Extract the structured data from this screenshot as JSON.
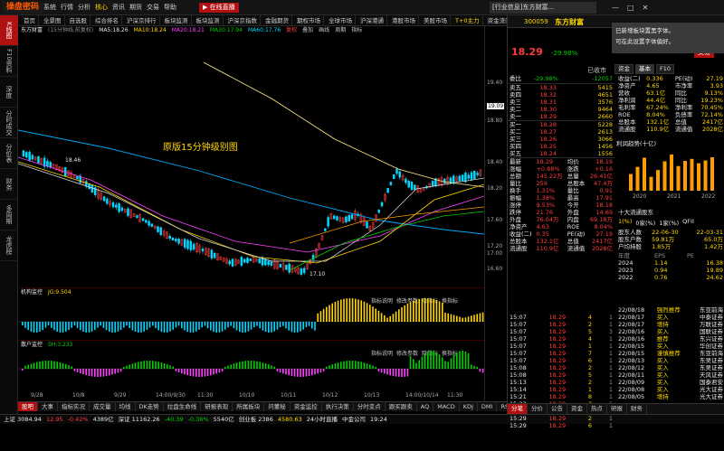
{
  "app": {
    "logo": "操盘密码",
    "menu": [
      "首页",
      "全景图",
      "自选股",
      "行情",
      "核心",
      "资讯",
      "交易",
      "数据"
    ],
    "menu2": [
      "系统",
      "行情",
      "分析",
      "核心",
      "资讯",
      "期货",
      "交易",
      "帮助"
    ],
    "ticker": "[行业信息]东方财富...",
    "window_controls": [
      "—",
      "□",
      "✕"
    ]
  },
  "top_menu": [
    "首页",
    "全景图",
    "自选股",
    "综合排名",
    "沪深京排行",
    "板块监测",
    "板块监测",
    "沪深京指数",
    "金融期货",
    "期权市场",
    "全球市场",
    "沪深港通",
    "港股市场",
    "美股市场",
    "T+0主力",
    "资金流向"
  ],
  "stock": {
    "code": "300059",
    "name": "东方财富",
    "price": "18.29",
    "change": "-29.98%",
    "status": "已收市",
    "tabs": [
      "资金",
      "基本",
      "F10"
    ],
    "btn": "交易"
  },
  "notice": {
    "l1": "已新增板块置黑字体。",
    "l2": "可在此设置字体偏好。"
  },
  "sidenav": [
    "K线图",
    "F10资料",
    "深度",
    "分时成交",
    "分价表",
    "财务",
    "多周期",
    "龙虎榜"
  ],
  "period_tabs": [
    "1分",
    "5日",
    "1分钟",
    "5分钟",
    "15分钟",
    "30分钟",
    "60分钟",
    "日线",
    "周线",
    "月线",
    "更多周期"
  ],
  "chart_head": {
    "name": "东方财富",
    "period": "(15分钟线,前复权)",
    "ma": [
      {
        "n": "MA5",
        "v": "18.26"
      },
      {
        "n": "MA10",
        "v": "18.24"
      },
      {
        "n": "MA20",
        "v": "18.21"
      },
      {
        "n": "MA30",
        "v": "17.94"
      },
      {
        "n": "MA60",
        "v": "17.76"
      }
    ],
    "links": [
      "复权",
      "叠加",
      "画线",
      "周期",
      "指标"
    ]
  },
  "watermark": "原版15分钟级别图",
  "y_ticks": [
    "19.40",
    "19.09",
    "18.80",
    "18.40",
    "18.20",
    "17.60",
    "17.20",
    "17.00",
    "16.60"
  ],
  "chart_labels": {
    "high": "18.46",
    "low": "17.10",
    "cur": "19.09"
  },
  "x_ticks": [
    "9/28",
    "10/8",
    "9/29",
    "14:00/9/30",
    "11:30",
    "10/10",
    "10/11",
    "10/12",
    "10/13",
    "14:00/10/14",
    "11:30"
  ],
  "ind1": {
    "name": "机构监控",
    "sub": "JG:9.504",
    "links": [
      "指标说明",
      "修改参数",
      "隐指标",
      "换指标"
    ]
  },
  "ind2": {
    "name": "散户监控",
    "sub": "SH:3.233",
    "links": [
      "指标说明",
      "修改参数",
      "隐指标",
      "换指标"
    ]
  },
  "bottom_tabs": [
    "股吧",
    "大事",
    "指标实况",
    "成交量",
    "均线",
    "DK走势",
    "拉盘生命线",
    "研报表现",
    "所属板块",
    "问董秘",
    "资金监控",
    "执行决策",
    "分时变点",
    "跟买跟卖",
    "AQ",
    "MACD",
    "KDJ",
    "DMI",
    "RSI"
  ],
  "status_bar": [
    "上证 3084.94",
    "12.95",
    "-0.42%",
    "4389亿",
    "深证 11162.26",
    "-40.39",
    "-0.36%",
    "5540亿",
    "创业板 2386",
    "4580.63",
    "24小时直播",
    "中金公司",
    "19:24"
  ],
  "order_book": {
    "weibi": {
      "l": "委比",
      "v": "-29.98%",
      "diff": "-12057"
    },
    "sell": [
      [
        "卖五",
        "18.33",
        "5415"
      ],
      [
        "卖四",
        "18.32",
        "4651"
      ],
      [
        "卖三",
        "18.31",
        "3576"
      ],
      [
        "卖二",
        "18.30",
        "9464"
      ],
      [
        "卖一",
        "18.29",
        "2660"
      ]
    ],
    "buy": [
      [
        "买一",
        "18.28",
        "5228"
      ],
      [
        "买二",
        "18.27",
        "2613"
      ],
      [
        "买三",
        "18.26",
        "3066"
      ],
      [
        "买四",
        "18.25",
        "1456"
      ],
      [
        "买五",
        "18.24",
        "1556"
      ]
    ]
  },
  "quote_table": [
    [
      "最新",
      "18.29",
      "均价",
      "18.19"
    ],
    [
      "涨幅",
      "+0.88%",
      "涨跌",
      "+0.16"
    ],
    [
      "总额",
      "145.22万",
      "总量",
      "26.41亿"
    ],
    [
      "量比",
      "259",
      "总股本",
      "47.4万"
    ],
    [
      "换手",
      "1.31%",
      "量比",
      "0.91"
    ],
    [
      "振幅",
      "1.38%",
      "最高",
      "17.91"
    ],
    [
      "涨停",
      "9.53%",
      "今开",
      "18.18"
    ],
    [
      "跌停",
      "21.76",
      "外盘",
      "14.69"
    ],
    [
      "外盘",
      "76.04万",
      "内盘",
      "69.18万"
    ],
    [
      "净资产",
      "4.63",
      "ROE",
      "8.04%"
    ],
    [
      "收益(二)",
      "0.35",
      "PE(动)",
      "27.19"
    ],
    [
      "总股本",
      "132.1亿",
      "总值",
      "2417亿"
    ],
    [
      "流通股",
      "110.9亿",
      "流通值",
      "2028亿"
    ]
  ],
  "fin": {
    "tabs": [
      "资金",
      "基本",
      "F10"
    ],
    "rows": [
      [
        "收益(二)",
        "0.336",
        "PE(动)",
        "27.19"
      ],
      [
        "净资产",
        "4.65",
        "市净率",
        "3.93"
      ],
      [
        "营收",
        "63.1亿",
        "同比",
        "9.13%"
      ],
      [
        "净利润",
        "44.4亿",
        "同比",
        "19.23%"
      ],
      [
        "毛利率",
        "67.24%",
        "净利率",
        "70.45%"
      ],
      [
        "ROE",
        "8.04%",
        "负债率",
        "72.14%"
      ],
      [
        "总股本",
        "132.1亿",
        "总值",
        "2417亿"
      ],
      [
        "流通股",
        "110.9亿",
        "流通值",
        "2028亿"
      ]
    ]
  },
  "profit_trend": {
    "title": "利润趋势(十亿)",
    "years": [
      "2020",
      "2021",
      "2022"
    ],
    "values": [
      4.2,
      6.0,
      8.3,
      3.5,
      5.2,
      7.4,
      9.1,
      6.2,
      7.5,
      8.0,
      6.9,
      7.6,
      8.4
    ]
  },
  "shareholder": {
    "title": "十大流通股东",
    "tabs": [
      "1(%)",
      "0家(%)",
      "1家(%)",
      "QFII"
    ],
    "rows": [
      [
        "股东人数",
        "22-06-30",
        "22-03-31"
      ],
      [
        "股东户数",
        "59.81万",
        "65.0万"
      ],
      [
        "户均持股",
        "1.85万",
        "1.42万"
      ]
    ]
  },
  "hist": {
    "head": [
      "年度",
      "EPS",
      "PE"
    ],
    "rows": [
      [
        "2024",
        "1.14",
        "16.38"
      ],
      [
        "2023",
        "0.94",
        "19.89"
      ],
      [
        "2022",
        "0.76",
        "24.62"
      ]
    ]
  },
  "ticks": [
    [
      "15:07",
      "18.29",
      "4",
      "1"
    ],
    [
      "15:07",
      "18.29",
      "2",
      "1"
    ],
    [
      "15:07",
      "18.29",
      "5",
      "3"
    ],
    [
      "15:07",
      "18.29",
      "4",
      "1"
    ],
    [
      "15:07",
      "18.29",
      "1",
      "1"
    ],
    [
      "15:07",
      "18.29",
      "7",
      "1"
    ],
    [
      "15:07",
      "18.29",
      "6",
      "1"
    ],
    [
      "15:08",
      "18.29",
      "2",
      "1"
    ],
    [
      "15:08",
      "18.29",
      "5",
      "1"
    ],
    [
      "15:13",
      "18.29",
      "2",
      "1"
    ],
    [
      "15:14",
      "18.29",
      "1",
      "1"
    ],
    [
      "15:21",
      "18.29",
      "8",
      "1"
    ],
    [
      "15:22",
      "18.29",
      "3",
      "1"
    ],
    [
      "15:28",
      "18.29",
      "4",
      "1"
    ],
    [
      "15:29",
      "18.29",
      "2",
      "1"
    ],
    [
      "15:29",
      "18.29",
      "6",
      "1"
    ]
  ],
  "broker": [
    [
      "22/08/18",
      "强烈推荐",
      "东亚前海"
    ],
    [
      "22/08/17",
      "买入",
      "中泰证券"
    ],
    [
      "22/08/17",
      "增持",
      "万联证券"
    ],
    [
      "22/08/16",
      "买入",
      "国联证券"
    ],
    [
      "22/08/16",
      "推荐",
      "东兴证券"
    ],
    [
      "22/08/15",
      "买入",
      "华创证券"
    ],
    [
      "22/08/15",
      "谨慎推荐",
      "东亚前海"
    ],
    [
      "22/08/13",
      "买入",
      "东吴证券"
    ],
    [
      "22/08/12",
      "买入",
      "东吴证券"
    ],
    [
      "22/08/11",
      "买入",
      "天风证券"
    ],
    [
      "22/08/09",
      "买入",
      "国泰君安"
    ],
    [
      "22/08/08",
      "买入",
      "光大证券"
    ],
    [
      "22/08/05",
      "增持",
      "光大证券"
    ]
  ],
  "right_bottom_tabs": [
    "分笔",
    "分价",
    "公告",
    "资金",
    "热点",
    "研报",
    "财务"
  ],
  "colors": {
    "up": "#ff3c3c",
    "down": "#00d000",
    "accent": "#ffd800",
    "brand": "#ff5a00"
  }
}
